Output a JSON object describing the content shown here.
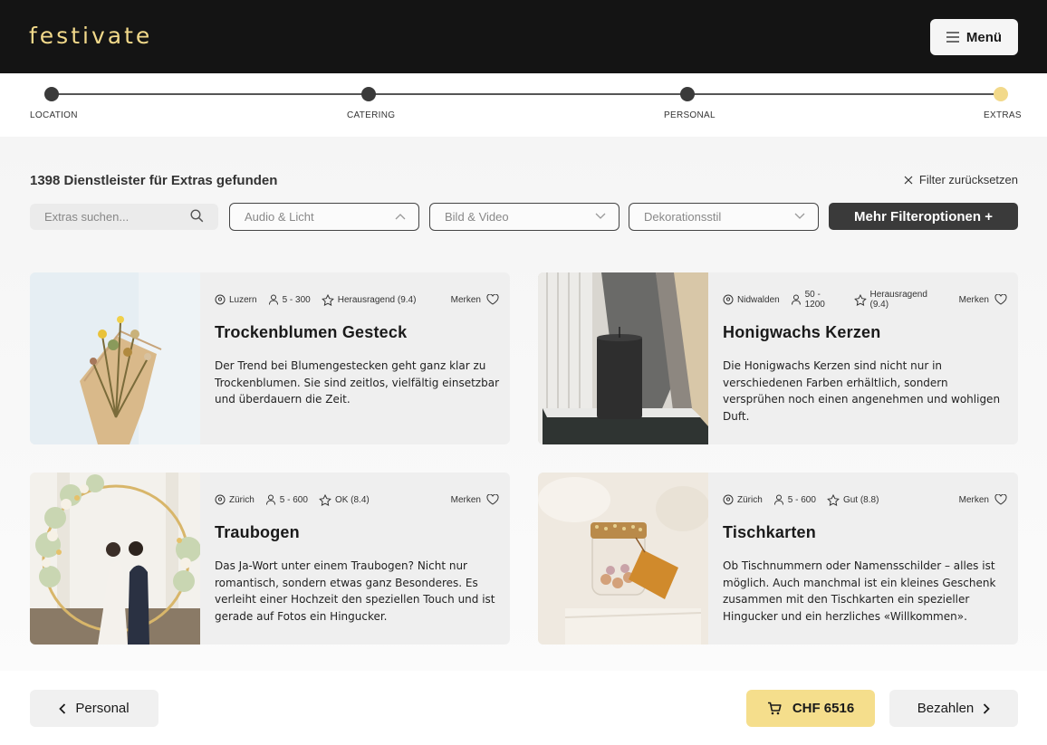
{
  "header": {
    "logo": "festivate",
    "menu_label": "Menü"
  },
  "stepper": {
    "steps": [
      {
        "label": "LOCATION",
        "state": "done"
      },
      {
        "label": "CATERING",
        "state": "done"
      },
      {
        "label": "PERSONAL",
        "state": "done"
      },
      {
        "label": "EXTRAS",
        "state": "active"
      }
    ]
  },
  "results": {
    "count_text": "1398 Dienstleister für Extras gefunden",
    "reset_label": "Filter zurücksetzen"
  },
  "filters": {
    "search_placeholder": "Extras suchen...",
    "dropdowns": [
      {
        "label": "Audio & Licht",
        "open": true
      },
      {
        "label": "Bild & Video",
        "open": false
      },
      {
        "label": "Dekorationsstil",
        "open": false
      }
    ],
    "more_label": "Mehr Filteroptionen +"
  },
  "cards": [
    {
      "location": "Luzern",
      "guests": "5 - 300",
      "rating": "Herausragend (9.4)",
      "save_label": "Merken",
      "title": "Trockenblumen Gesteck",
      "description": "Der Trend bei Blumengestecken geht ganz klar zu Trockenblumen. Sie sind zeitlos, vielfältig einsetzbar und überdauern die Zeit."
    },
    {
      "location": "Nidwalden",
      "guests": "50 - 1200",
      "rating": "Herausragend (9.4)",
      "save_label": "Merken",
      "title": "Honigwachs Kerzen",
      "description": "Die Honigwachs Kerzen sind nicht nur in verschiedenen Farben erhältlich, sondern versprühen noch einen angenehmen und wohligen Duft."
    },
    {
      "location": "Zürich",
      "guests": "5 - 600",
      "rating": "OK (8.4)",
      "save_label": "Merken",
      "title": "Traubogen",
      "description": "Das Ja-Wort unter einem Traubogen? Nicht nur romantisch, sondern etwas ganz Besonderes. Es verleiht einer Hochzeit den speziellen Touch und ist gerade auf Fotos ein Hingucker."
    },
    {
      "location": "Zürich",
      "guests": "5 - 600",
      "rating": "Gut (8.8)",
      "save_label": "Merken",
      "title": "Tischkarten",
      "description": "Ob Tischnummern oder Namensschilder – alles ist möglich. Auch manchmal ist ein kleines Geschenk zusammen mit den Tischkarten ein spezieller Hingucker und ein herzliches «Willkommen»."
    }
  ],
  "footer": {
    "back_label": "Personal",
    "cart_total": "CHF 6516",
    "pay_label": "Bezahlen"
  },
  "colors": {
    "accent": "#f2d98a",
    "header_bg": "#141414",
    "dark_button": "#3a3a3a"
  }
}
